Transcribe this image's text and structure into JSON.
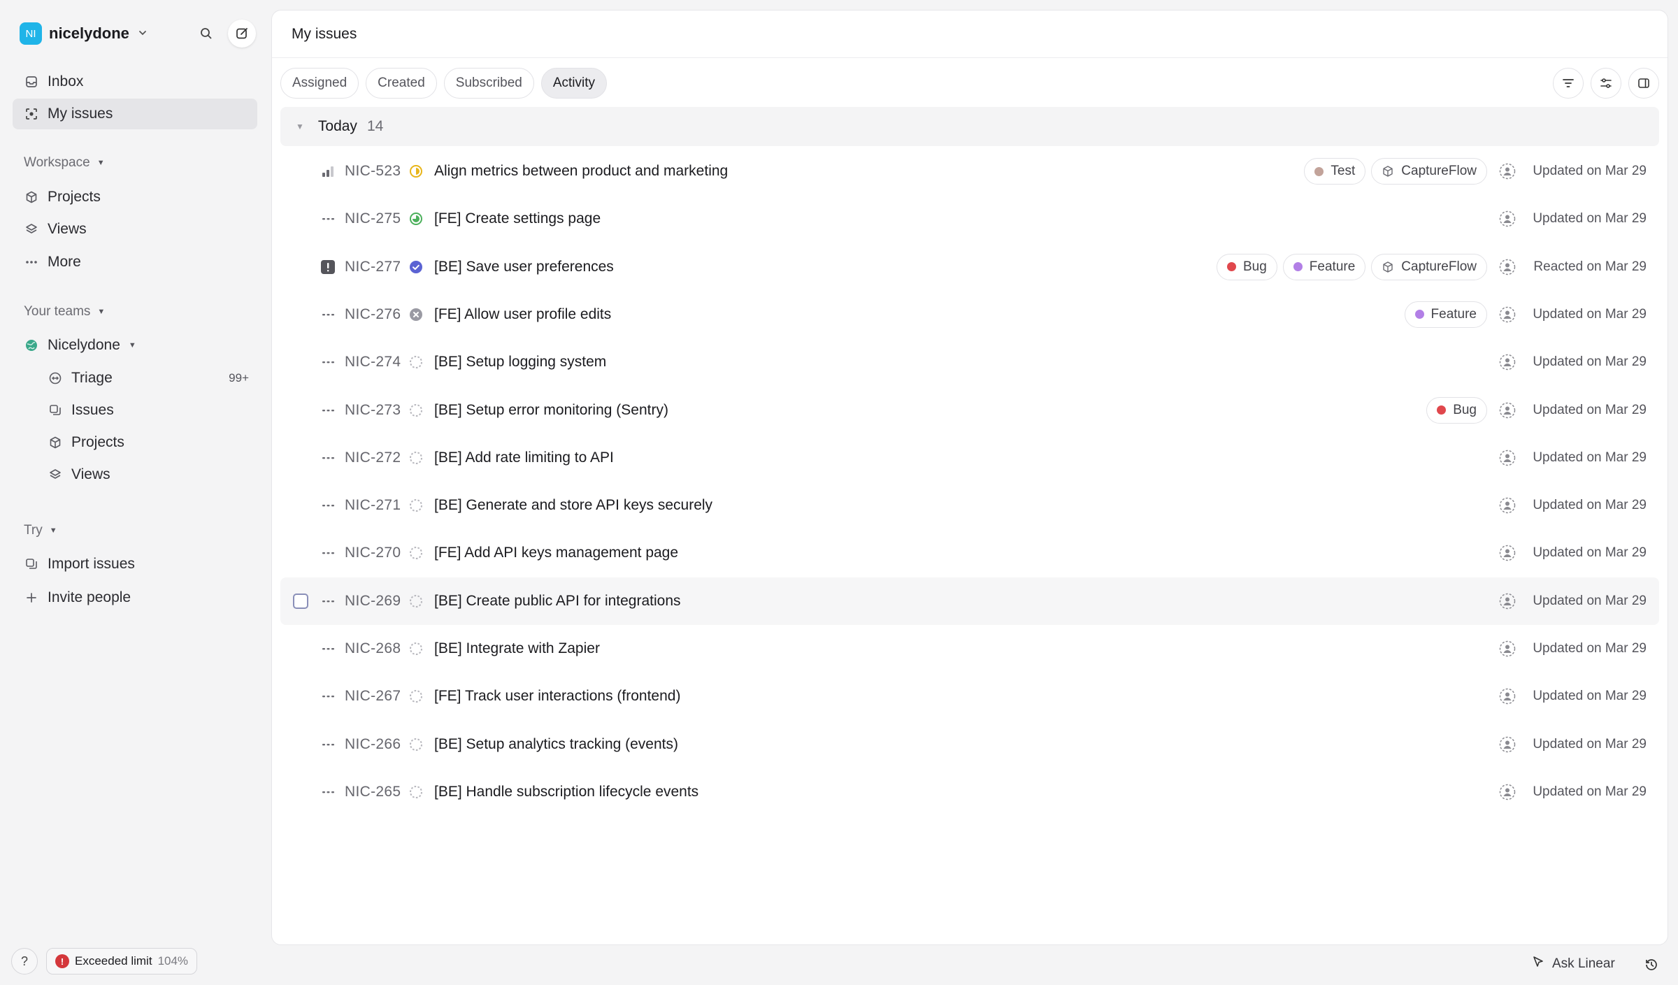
{
  "workspace": {
    "initials": "NI",
    "name": "nicelydone",
    "avatar_color": "#1fb4e8"
  },
  "nav": {
    "inbox": "Inbox",
    "my_issues": "My issues"
  },
  "workspace_section": {
    "header": "Workspace",
    "items": [
      "Projects",
      "Views",
      "More"
    ]
  },
  "teams_section": {
    "header": "Your teams",
    "team_name": "Nicelydone",
    "items": [
      {
        "label": "Triage",
        "badge": "99+"
      },
      {
        "label": "Issues"
      },
      {
        "label": "Projects"
      },
      {
        "label": "Views"
      }
    ]
  },
  "try_section": {
    "header": "Try",
    "import": "Import issues",
    "invite": "Invite people"
  },
  "bottom": {
    "help": "?",
    "limit_label": "Exceeded limit",
    "limit_pct": "104%"
  },
  "main": {
    "title": "My issues",
    "tabs": [
      "Assigned",
      "Created",
      "Subscribed",
      "Activity"
    ],
    "active_tab": "Activity",
    "group": {
      "title": "Today",
      "count": "14"
    }
  },
  "label_colors": {
    "Test": "#c2a39a",
    "Bug": "#e0474c",
    "Feature": "#b27fe6"
  },
  "status_colors": {
    "in_progress": "#e8b51a",
    "in_review": "#4cb05c",
    "done": "#5b63d3",
    "canceled": "#9a9aa3",
    "backlog": "#b7b7bd"
  },
  "issues": [
    {
      "id": "NIC-523",
      "title": "Align metrics between product and marketing",
      "priority": "medium",
      "status": "in_progress",
      "labels": [
        "Test"
      ],
      "project": "CaptureFlow",
      "activity": "Updated on Mar 29"
    },
    {
      "id": "NIC-275",
      "title": "[FE] Create settings page",
      "priority": "none",
      "status": "in_review",
      "labels": [],
      "project": "",
      "activity": "Updated on Mar 29"
    },
    {
      "id": "NIC-277",
      "title": "[BE] Save user preferences",
      "priority": "urgent",
      "status": "done",
      "labels": [
        "Bug",
        "Feature"
      ],
      "project": "CaptureFlow",
      "activity": "Reacted on Mar 29"
    },
    {
      "id": "NIC-276",
      "title": "[FE] Allow user profile edits",
      "priority": "none",
      "status": "canceled",
      "labels": [
        "Feature"
      ],
      "project": "",
      "activity": "Updated on Mar 29"
    },
    {
      "id": "NIC-274",
      "title": "[BE] Setup logging system",
      "priority": "none",
      "status": "backlog",
      "labels": [],
      "project": "",
      "activity": "Updated on Mar 29"
    },
    {
      "id": "NIC-273",
      "title": "[BE] Setup error monitoring (Sentry)",
      "priority": "none",
      "status": "backlog",
      "labels": [
        "Bug"
      ],
      "project": "",
      "activity": "Updated on Mar 29"
    },
    {
      "id": "NIC-272",
      "title": "[BE] Add rate limiting to API",
      "priority": "none",
      "status": "backlog",
      "labels": [],
      "project": "",
      "activity": "Updated on Mar 29"
    },
    {
      "id": "NIC-271",
      "title": "[BE] Generate and store API keys securely",
      "priority": "none",
      "status": "backlog",
      "labels": [],
      "project": "",
      "activity": "Updated on Mar 29"
    },
    {
      "id": "NIC-270",
      "title": "[FE] Add API keys management page",
      "priority": "none",
      "status": "backlog",
      "labels": [],
      "project": "",
      "activity": "Updated on Mar 29"
    },
    {
      "id": "NIC-269",
      "title": "[BE] Create public API for integrations",
      "priority": "none",
      "status": "backlog",
      "labels": [],
      "project": "",
      "activity": "Updated on Mar 29",
      "hover": true
    },
    {
      "id": "NIC-268",
      "title": "[BE] Integrate with Zapier",
      "priority": "none",
      "status": "backlog",
      "labels": [],
      "project": "",
      "activity": "Updated on Mar 29"
    },
    {
      "id": "NIC-267",
      "title": "[FE] Track user interactions (frontend)",
      "priority": "none",
      "status": "backlog",
      "labels": [],
      "project": "",
      "activity": "Updated on Mar 29"
    },
    {
      "id": "NIC-266",
      "title": "[BE] Setup analytics tracking (events)",
      "priority": "none",
      "status": "backlog",
      "labels": [],
      "project": "",
      "activity": "Updated on Mar 29"
    },
    {
      "id": "NIC-265",
      "title": "[BE] Handle subscription lifecycle events",
      "priority": "none",
      "status": "backlog",
      "labels": [],
      "project": "",
      "activity": "Updated on Mar 29"
    }
  ],
  "footer": {
    "ask": "Ask Linear"
  }
}
